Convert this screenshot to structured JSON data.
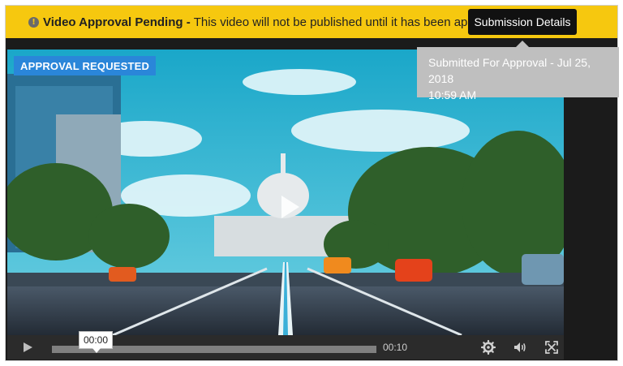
{
  "banner": {
    "title": "Video Approval Pending -",
    "message": "This video will not be published until it has been approved.",
    "info_icon": "info-circle-icon",
    "background": "#f6c80f"
  },
  "submission_button": {
    "label": "Submission Details"
  },
  "tooltip": {
    "line1": "Submitted For Approval - Jul 25, 2018",
    "line2": "10:59 AM"
  },
  "video": {
    "badge": "APPROVAL REQUESTED",
    "play_icon": "play-circle-icon"
  },
  "controls": {
    "current_time": "00:00",
    "duration": "00:10",
    "play_icon": "play-icon",
    "settings_icon": "gear-icon",
    "volume_icon": "volume-icon",
    "fullscreen_icon": "fullscreen-icon"
  },
  "colors": {
    "badge_blue": "#2a86d9",
    "controls_bg": "#2b2b2b",
    "tooltip_bg": "#bfbfbf"
  }
}
